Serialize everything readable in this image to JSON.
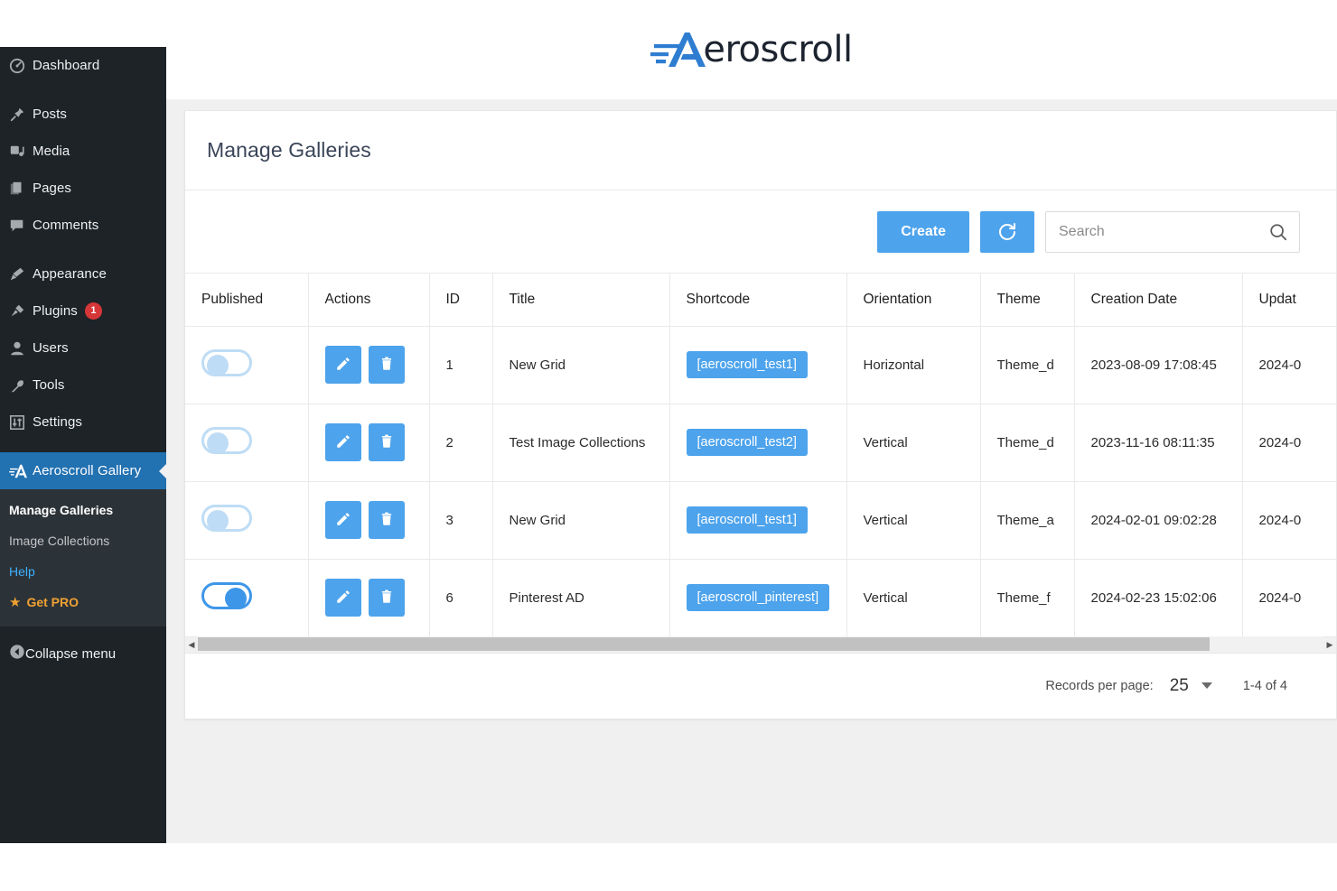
{
  "brand": {
    "logo_text": "eroscroll",
    "logo_icon": "aeroscroll-a-logo",
    "accent_blue": "#2e7dd1",
    "logo_dark": "#1d2430"
  },
  "sidebar": {
    "background": "#1d2327",
    "active_background": "#2271b1",
    "items": [
      {
        "label": "Dashboard",
        "icon": "dashboard-icon"
      },
      {
        "label": "Posts",
        "icon": "pin-icon"
      },
      {
        "label": "Media",
        "icon": "media-icon"
      },
      {
        "label": "Pages",
        "icon": "pages-icon"
      },
      {
        "label": "Comments",
        "icon": "comment-icon"
      },
      {
        "label": "Appearance",
        "icon": "brush-icon"
      },
      {
        "label": "Plugins",
        "icon": "plug-icon",
        "badge": "1"
      },
      {
        "label": "Users",
        "icon": "user-icon"
      },
      {
        "label": "Tools",
        "icon": "wrench-icon"
      },
      {
        "label": "Settings",
        "icon": "sliders-icon"
      },
      {
        "label": "Aeroscroll Gallery",
        "icon": "aeroscroll-a-logo",
        "active": true
      }
    ],
    "submenu": [
      {
        "label": "Manage Galleries",
        "state": "current"
      },
      {
        "label": "Image Collections",
        "state": "normal"
      },
      {
        "label": "Help",
        "state": "link"
      },
      {
        "label": "Get PRO",
        "state": "pro",
        "icon": "star-icon"
      }
    ],
    "collapse": {
      "label": "Collapse menu",
      "icon": "collapse-arrow-icon"
    }
  },
  "page": {
    "title": "Manage Galleries"
  },
  "toolbar": {
    "create_label": "Create",
    "refresh_icon": "refresh-icon",
    "search_placeholder": "Search",
    "search_value": "",
    "search_icon": "search-icon"
  },
  "table": {
    "columns": [
      "Published",
      "Actions",
      "ID",
      "Title",
      "Shortcode",
      "Orientation",
      "Theme",
      "Creation Date",
      "Updat"
    ],
    "rows": [
      {
        "published": false,
        "edit_icon": "pencil-icon",
        "delete_icon": "trash-icon",
        "id": "1",
        "title": "New Grid",
        "shortcode": "[aeroscroll_test1]",
        "orientation": "Horizontal",
        "theme": "Theme_d",
        "creation_date": "2023-08-09 17:08:45",
        "updated_date": "2024-0"
      },
      {
        "published": false,
        "edit_icon": "pencil-icon",
        "delete_icon": "trash-icon",
        "id": "2",
        "title": "Test Image Collections",
        "shortcode": "[aeroscroll_test2]",
        "orientation": "Vertical",
        "theme": "Theme_d",
        "creation_date": "2023-11-16 08:11:35",
        "updated_date": "2024-0"
      },
      {
        "published": false,
        "edit_icon": "pencil-icon",
        "delete_icon": "trash-icon",
        "id": "3",
        "title": "New Grid",
        "shortcode": "[aeroscroll_test1]",
        "orientation": "Vertical",
        "theme": "Theme_a",
        "creation_date": "2024-02-01 09:02:28",
        "updated_date": "2024-0"
      },
      {
        "published": true,
        "edit_icon": "pencil-icon",
        "delete_icon": "trash-icon",
        "id": "6",
        "title": "Pinterest AD",
        "shortcode": "[aeroscroll_pinterest]",
        "orientation": "Vertical",
        "theme": "Theme_f",
        "creation_date": "2024-02-23 15:02:06",
        "updated_date": "2024-0"
      }
    ]
  },
  "footer": {
    "records_per_page_label": "Records per page:",
    "records_per_page_value": "25",
    "range_label": "1-4 of 4"
  },
  "colors": {
    "primary_blue": "#4da3ec",
    "toggle_off": "#bedcf5",
    "toggle_on": "#3d96e8",
    "badge_red": "#d63638",
    "pro_orange": "#f0a132"
  }
}
